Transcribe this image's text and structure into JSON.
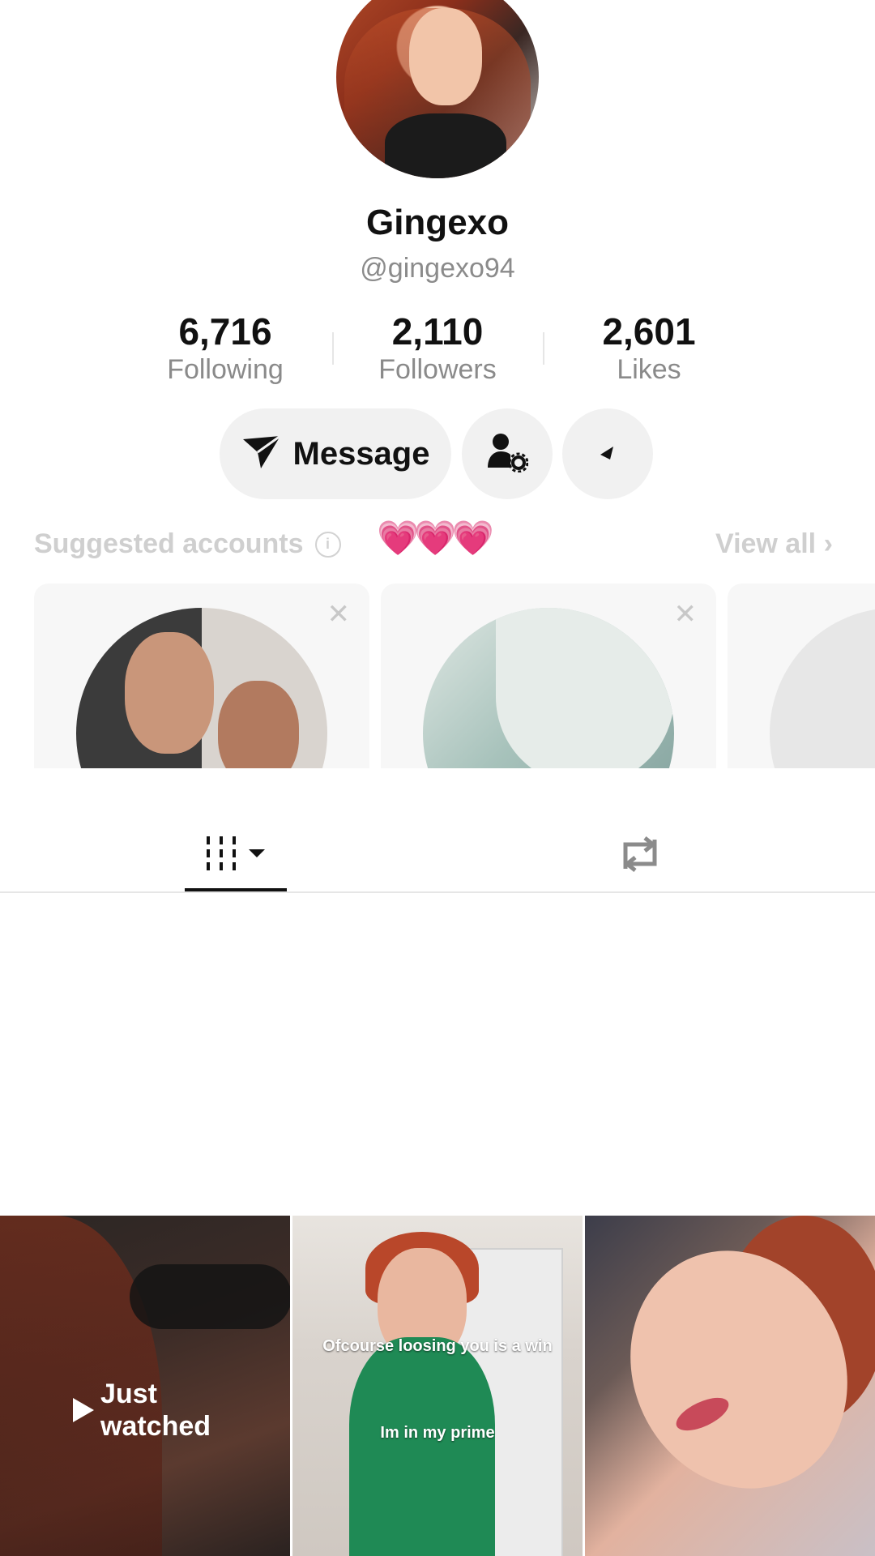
{
  "profile": {
    "display_name": "Gingexo",
    "handle": "@gingexo94"
  },
  "stats": [
    {
      "value": "6,716",
      "label": "Following"
    },
    {
      "value": "2,110",
      "label": "Followers"
    },
    {
      "value": "2,601",
      "label": "Likes"
    }
  ],
  "actions": {
    "message_label": "Message"
  },
  "suggested": {
    "title": "Suggested accounts",
    "decoration": "💗💗💗",
    "view_all_label": "View all"
  },
  "videos": {
    "just_watched": "Just watched",
    "tile2_caption_1": "Ofcourse loosing you is a win",
    "tile2_caption_2": "Im in my prime"
  },
  "colors": {
    "accent_text": "#111111",
    "muted_text": "#8a8a8a",
    "button_bg": "#f1f1f1"
  }
}
